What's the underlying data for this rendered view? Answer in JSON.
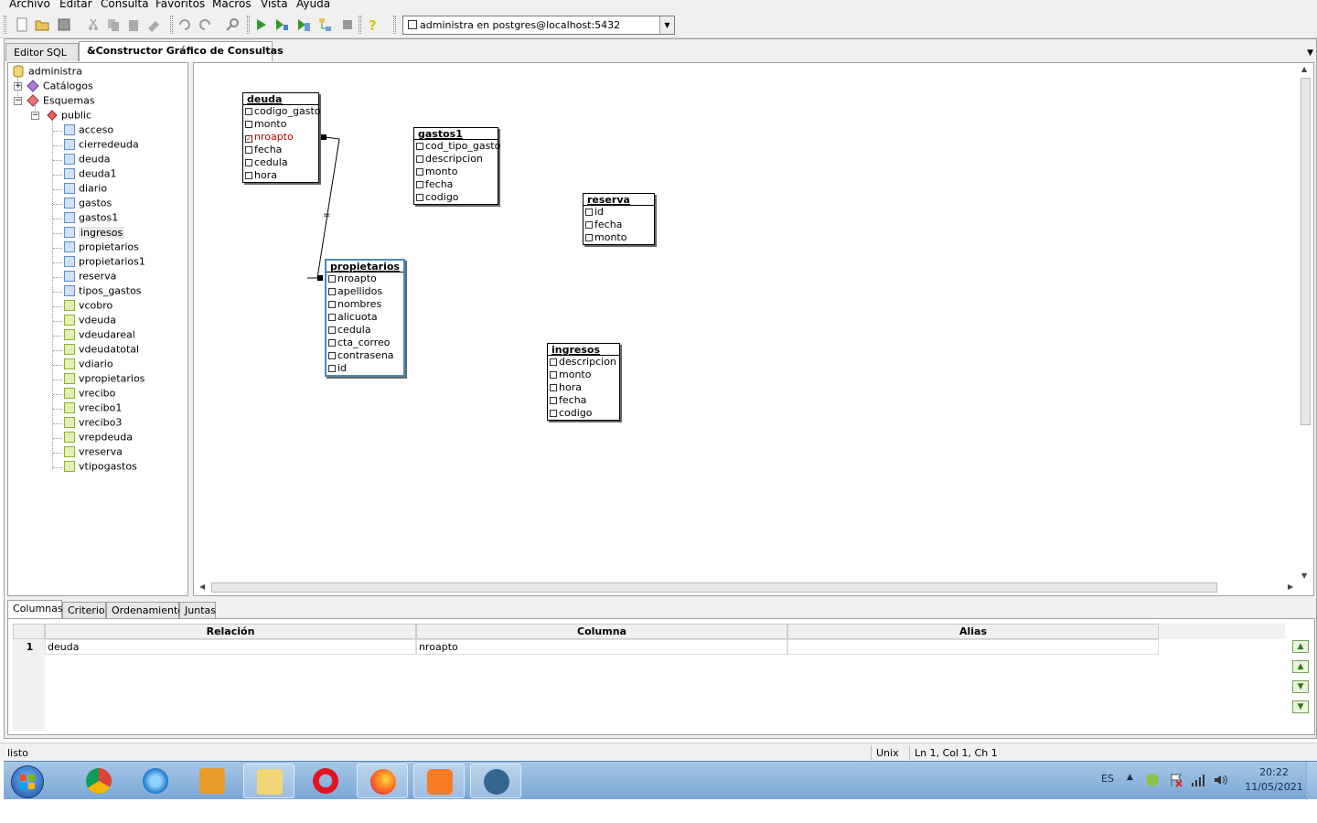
{
  "menu": [
    "Archivo",
    "Editar",
    "Consulta",
    "Favoritos",
    "Macros",
    "Vista",
    "Ayuda"
  ],
  "toolbar": {
    "connection": "administra en postgres@localhost:5432"
  },
  "tabs": [
    "Editor SQL",
    "&Constructor Gráfico de Consultas"
  ],
  "tree": {
    "root": "administra",
    "catalogs": "Catálogos",
    "schemas": "Esquemas",
    "schema": "public",
    "tables": [
      "acceso",
      "cierredeuda",
      "deuda",
      "deuda1",
      "diario",
      "gastos",
      "gastos1",
      "ingresos",
      "propietarios",
      "propietarios1",
      "reserva",
      "tipos_gastos"
    ],
    "views": [
      "vcobro",
      "vdeuda",
      "vdeudareal",
      "vdeudatotal",
      "vdiario",
      "vpropietarios",
      "vrecibo",
      "vrecibo1",
      "vrecibo3",
      "vrepdeuda",
      "vreserva",
      "vtipogastos"
    ],
    "selected": "ingresos"
  },
  "canvas": {
    "tables": [
      {
        "name": "deuda",
        "columns": [
          "codigo_gasto",
          "monto",
          "nroapto",
          "fecha",
          "cedula",
          "hora"
        ],
        "checked": [
          "nroapto"
        ]
      },
      {
        "name": "gastos1",
        "columns": [
          "cod_tipo_gasto",
          "descripcion",
          "monto",
          "fecha",
          "codigo"
        ],
        "checked": []
      },
      {
        "name": "reserva",
        "columns": [
          "id",
          "fecha",
          "monto"
        ],
        "checked": []
      },
      {
        "name": "propietarios",
        "columns": [
          "nroapto",
          "apellidos",
          "nombres",
          "alicuota",
          "cedula",
          "cta_correo",
          "contrasena",
          "id"
        ],
        "checked": []
      },
      {
        "name": "ingresos",
        "columns": [
          "descripcion",
          "monto",
          "hora",
          "fecha",
          "codigo"
        ],
        "checked": []
      }
    ],
    "join_label": "="
  },
  "bottom_tabs": [
    "Columnas",
    "Criterio",
    "Ordenamiento",
    "Juntas"
  ],
  "grid": {
    "headers": [
      "Relación",
      "Columna",
      "Alias"
    ],
    "rows": [
      {
        "num": "1",
        "relation": "deuda",
        "column": "nroapto",
        "alias": ""
      }
    ]
  },
  "status": {
    "message": "listo",
    "line_ending": "Unix",
    "position": "Ln 1, Col 1, Ch 1"
  },
  "taskbar": {
    "lang": "ES",
    "time": "20:22",
    "date": "11/05/2021"
  }
}
